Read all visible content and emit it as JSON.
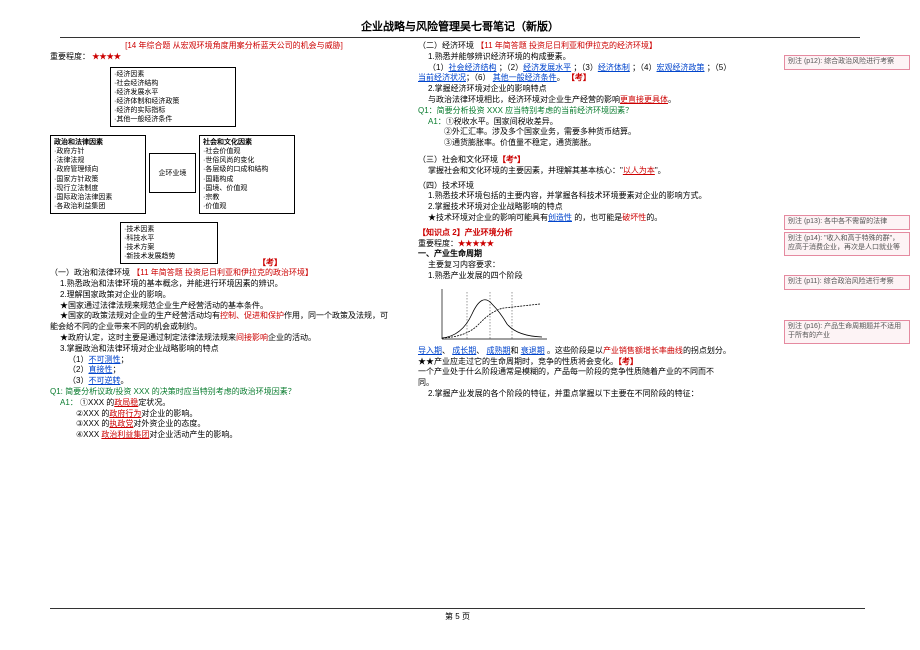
{
  "title": "企业战略与风险管理吴七哥笔记（新版）",
  "left": {
    "examRef": "[14 年综合题  从宏观环境角度用案分析蓝天公司的机会与威胁]",
    "imp_label": "重要程度：",
    "imp_stars": "★★★★",
    "diagram": {
      "top": [
        "·经济因素",
        "·社会经济结构",
        "·经济发展水平",
        "·经济体制和经济政策",
        "·经济的实际指标",
        "·其他一般经济条件"
      ],
      "left_title": "政治和法律因素",
      "left": [
        "·政府方针",
        "·法律法规",
        "·政府管理倾向",
        "·国家方针政策",
        "·现行立法制度",
        "·国际政治法律因素",
        "·各政治利益集团"
      ],
      "right_title": "社会和文化因素",
      "right": [
        "·社会价值观",
        "·世俗风尚的变化",
        "·各层级的口成和结构",
        "·国籍构成",
        "·国境、价值观",
        "·宗教",
        "·价值观"
      ],
      "bottom": [
        "·技术因素",
        "·科技水平",
        "·技术方案",
        "·新技术发展趋势"
      ],
      "center": [
        "企",
        "业",
        "环",
        "境"
      ],
      "kao": "【考】"
    },
    "sec1_title": "（一）政治和法律环境",
    "sec1_ref": "【11 年简答题  投资尼日利亚和伊拉克的政治环境】",
    "sec1_l1": "1.熟悉政治和法律环境的基本概念，并能进行环境因素的辨识。",
    "sec1_l2": "2.理解国家政策对企业的影响。",
    "sec1_l3": "★国家通过法律法规来规范企业生产经营活动的基本条件。",
    "sec1_l4a": "★国家的政策法规对企业的生产经营活动均有",
    "sec1_l4b": "控制、促进和保护",
    "sec1_l4c": "作用，同一个政策及法规，可",
    "sec1_l5": "能会给不同的企业带来不同的机会或制约。",
    "sec1_l6a": "★政府认定，这时主要是通过制定法律法规法规来",
    "sec1_l6b": "间接影响",
    "sec1_l6c": "企业的活动。",
    "sec1_l7": "3.掌握政治和法律环境对企业战略影响的特点",
    "sec1_l8": "（1）",
    "sec1_l8b": "不可测性",
    "sec1_l9": "（2）",
    "sec1_l9b": "直接性",
    "sec1_l10": "（3）",
    "sec1_l10b": "不可逆转",
    "q1": "Q1: 简要分析议政/投资 XXX 的决策时应当特别考虑的政治环境因素？",
    "a1_label": "A1：",
    "a1_1a": "①XXX 的",
    "a1_1b": "政局稳",
    "a1_1c": "定状况。",
    "a1_2a": "②XXX 的",
    "a1_2b": "政府行为",
    "a1_2c": "对企业的影响。",
    "a1_3a": "③XXX 的",
    "a1_3b": "执政党",
    "a1_3c": "对外资企业的态度。",
    "a1_4a": "④XXX ",
    "a1_4b": "政治利益集团",
    "a1_4c": "对企业活动产生的影响。"
  },
  "right": {
    "sec2_title": "（二）经济环境",
    "sec2_ref": "【11 年简答题  投资尼日利亚和伊拉克的经济环境】",
    "sec2_l1": "1.熟悉并能够辨识经济环境的构成要素。",
    "sec2_l2a": "（1）",
    "sec2_l2b": "社会经济结构",
    "sec2_l2c": "；（2）",
    "sec2_l2d": "经济发展水平",
    "sec2_l2e": "；（3）",
    "sec2_l2f": "经济体制",
    "sec2_l2g": "；（4）",
    "sec2_l2h": "宏观经济政策",
    "sec2_l2i": "；（5）",
    "sec2_l3a": "当前经济状况",
    "sec2_l3b": "；（6）",
    "sec2_l3c": "其他一般经济条件",
    "sec2_l3d": "。",
    "sec2_kao1": "【考】",
    "sec2_l4": "2.掌握经济环境对企业的影响特点",
    "sec2_l5a": "与政治法律环境相比，经济环境对企业生产经营的影响",
    "sec2_l5b": "更直接更具体",
    "sec2_l5c": "。",
    "q1": "Q1：简要分析投资 XXX 应当特别考虑的当前经济环境因素？",
    "a1_label": "A1：",
    "a1_1": "①税收水平。国家间税收差异。",
    "a1_2": "②外汇汇率。涉及多个国家业务，需要多种货币结算。",
    "a1_3": "③通货膨胀率。价值量不稳定，通货膨胀。",
    "sec3_title": "（三）社会和文化环境",
    "sec3_kao": "【考*】",
    "sec3_l1a": "掌握社会和文化环境的主要因素，并理解其基本核心：\"",
    "sec3_l1b": "以人为本",
    "sec3_l1c": "\"。",
    "sec4_title": "（四）技术环境",
    "sec4_l1": "1.熟悉技术环境包括的主要内容，并掌握各科技术环境要素对企业的影响方式。",
    "sec4_l2": "2.掌握技术环境对企业战略影响的特点",
    "sec4_l3a": "★技术环境对企业的影响可能具有",
    "sec4_l3b": "创造性",
    "sec4_l3c": "的，也可能是",
    "sec4_l3d": "破坏性",
    "sec4_l3e": "的。",
    "kp_title": "【知识点 2】产业环境分析",
    "kp_imp_label": "重要程度：",
    "kp_imp_stars": "★★★★★",
    "plc_title": "一、产业生命周期",
    "plc_l1": "主要复习内容要求：",
    "plc_l2": "1.熟悉产业发展的四个阶段",
    "stages_a": "导入期",
    "stages_b": "成长期",
    "stages_c": "成熟期",
    "stages_d": "衰退期",
    "stages_mid": "、",
    "stages_and": "和",
    "stages_tail1": "。这些阶段是以",
    "stages_tail1b": "产业销售额增长率曲线",
    "stages_tail2": "的拐点划分。",
    "plc_l4": "★★产业应走过它的生命周期时，竞争的性质将会变化。",
    "plc_kao": "【考】",
    "plc_l5": "一个产业处于什么阶段通常是模糊的，产品每一阶段的竞争性质随着产业的不同而不",
    "plc_l6": "同。",
    "plc_l7": "2.掌握产业发展的各个阶段的特征，并重点掌握以下主要在不同阶段的特征："
  },
  "notes": {
    "n1": "别注 (p12): 综合政治风险进行考察",
    "n2": "别注 (p13): 各中各不需留的法律",
    "n3": "别注 (p14): \"收入和高于特殊的群\"，应高于消费企业，再次是人口就业等",
    "n4": "别注 (p11): 综合政治风险进行考察",
    "n5": "别注 (p16): 产品生命周期题并不适用于所有的产业"
  },
  "footer": "第 5 页"
}
